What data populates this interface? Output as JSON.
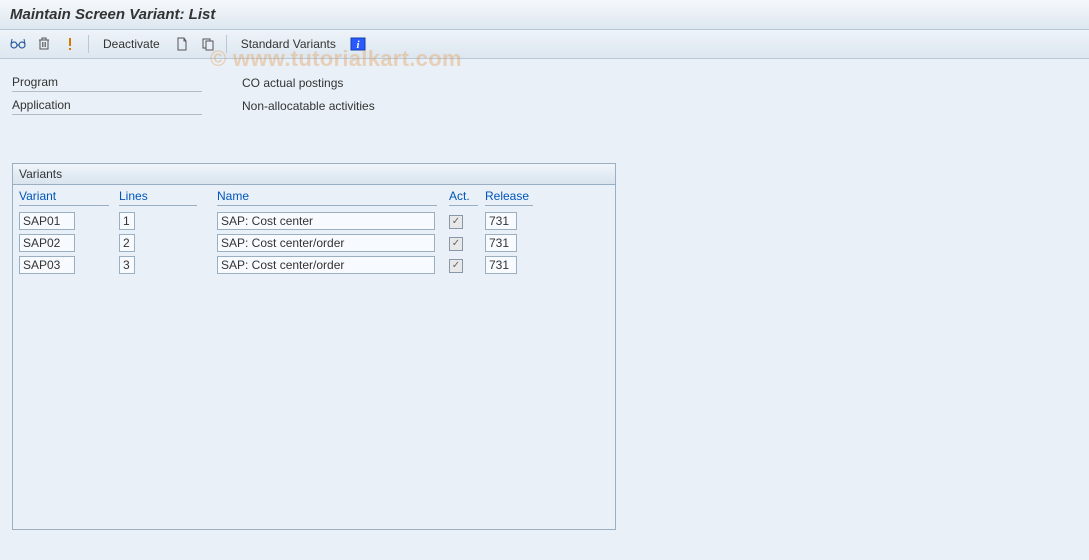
{
  "title": "Maintain Screen Variant: List",
  "watermark": "© www.tutorialkart.com",
  "toolbar": {
    "deactivate_label": "Deactivate",
    "standard_variants_label": "Standard Variants"
  },
  "info": {
    "program_label": "Program",
    "program_value": "CO actual postings",
    "application_label": "Application",
    "application_value": "Non-allocatable activities"
  },
  "variants": {
    "box_title": "Variants",
    "columns": {
      "variant": "Variant",
      "lines": "Lines",
      "name": "Name",
      "act": "Act.",
      "release": "Release"
    },
    "rows": [
      {
        "variant": "SAP01",
        "lines": "1",
        "name": "SAP: Cost center",
        "active": true,
        "release": "731"
      },
      {
        "variant": "SAP02",
        "lines": "2",
        "name": "SAP: Cost center/order",
        "active": true,
        "release": "731"
      },
      {
        "variant": "SAP03",
        "lines": "3",
        "name": "SAP: Cost center/order",
        "active": true,
        "release": "731"
      }
    ]
  }
}
